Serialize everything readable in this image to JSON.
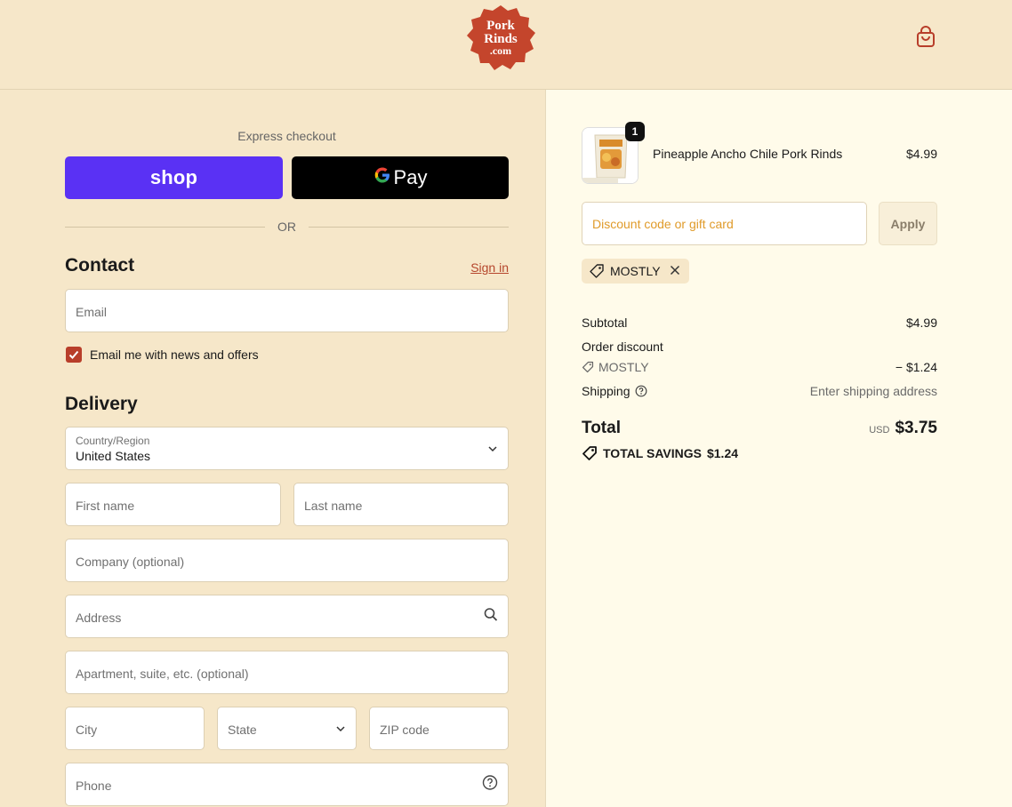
{
  "header": {
    "logo_text": [
      "Pork",
      "Rinds",
      ".com"
    ],
    "cart_icon": "shopping-bag-icon"
  },
  "express": {
    "title": "Express checkout",
    "shop_label": "shop",
    "gpay_g": "G",
    "gpay_label": "Pay",
    "or_label": "OR"
  },
  "contact": {
    "heading": "Contact",
    "sign_in": "Sign in",
    "email_placeholder": "Email",
    "news_checked": true,
    "news_label": "Email me with news and offers"
  },
  "delivery": {
    "heading": "Delivery",
    "country_label": "Country/Region",
    "country_value": "United States",
    "first_name": "First name",
    "last_name": "Last name",
    "company": "Company (optional)",
    "address": "Address",
    "apartment": "Apartment, suite, etc. (optional)",
    "city": "City",
    "state": "State",
    "zip": "ZIP code",
    "phone": "Phone"
  },
  "summary": {
    "item": {
      "quantity": "1",
      "name": "Pineapple Ancho Chile Pork Rinds",
      "price": "$4.99"
    },
    "discount_placeholder": "Discount code or gift card",
    "apply_label": "Apply",
    "applied_code": "MOSTLY",
    "subtotal_label": "Subtotal",
    "subtotal_value": "$4.99",
    "order_discount_label": "Order discount",
    "order_discount_code": "MOSTLY",
    "order_discount_value": "− $1.24",
    "shipping_label": "Shipping",
    "shipping_value": "Enter shipping address",
    "total_label": "Total",
    "total_currency": "USD",
    "total_value": "$3.75",
    "savings_label": "TOTAL SAVINGS",
    "savings_value": "$1.24"
  },
  "colors": {
    "page_bg": "#f6e7c9",
    "summary_bg": "#fffbea",
    "shop_purple": "#5a31f4",
    "brand_red": "#b83e2a",
    "link": "#b5462c",
    "discount_placeholder": "#e09b2a"
  }
}
